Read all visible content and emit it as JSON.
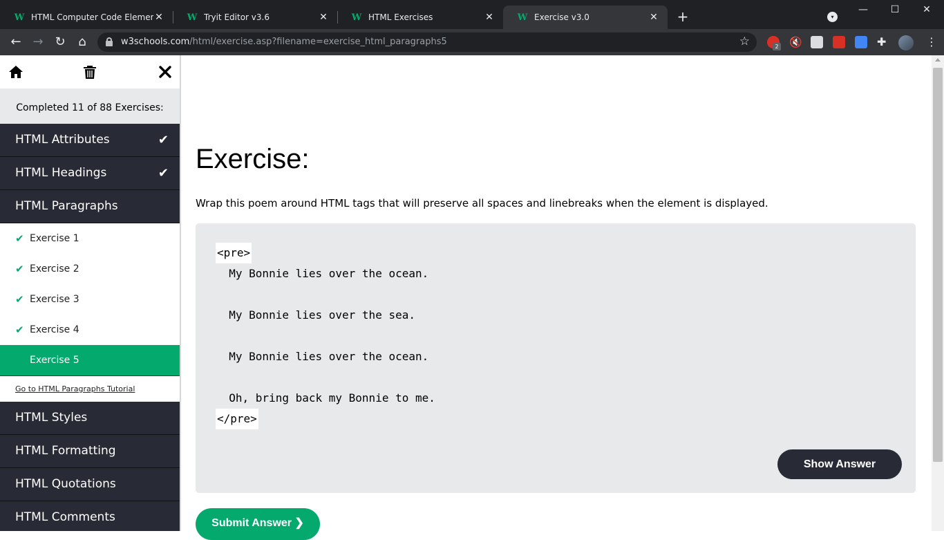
{
  "browser": {
    "tabs": [
      {
        "title": "HTML Computer Code Elements",
        "favicon": "w3schools-icon",
        "active": false
      },
      {
        "title": "Tryit Editor v3.6",
        "favicon": "w3schools-icon",
        "active": false
      },
      {
        "title": "HTML Exercises",
        "favicon": "w3schools-icon",
        "active": false
      },
      {
        "title": "Exercise v3.0",
        "favicon": "w3schools-icon",
        "active": true
      }
    ],
    "favicon_glyph": "W",
    "close_glyph": "✕",
    "new_tab_glyph": "+",
    "url_host": "w3schools.com",
    "url_path": "/html/exercise.asp?filename=exercise_html_paragraphs5",
    "extension_badge": "2"
  },
  "sidebar": {
    "completed_text": "Completed 11 of 88 Exercises:",
    "categories_top": [
      {
        "label": "HTML Attributes",
        "done": true
      },
      {
        "label": "HTML Headings",
        "done": true
      },
      {
        "label": "HTML Paragraphs",
        "done": false
      }
    ],
    "exercises": [
      {
        "label": "Exercise 1",
        "done": true
      },
      {
        "label": "Exercise 2",
        "done": true
      },
      {
        "label": "Exercise 3",
        "done": true
      },
      {
        "label": "Exercise 4",
        "done": true
      },
      {
        "label": "Exercise 5",
        "done": false,
        "active": true
      }
    ],
    "tutorial_link": "Go to HTML Paragraphs Tutorial",
    "categories_bottom": [
      {
        "label": "HTML Styles"
      },
      {
        "label": "HTML Formatting"
      },
      {
        "label": "HTML Quotations"
      },
      {
        "label": "HTML Comments"
      }
    ]
  },
  "exercise": {
    "heading": "Exercise:",
    "instructions": "Wrap this poem around HTML tags that will preserve all spaces and linebreaks when the element is displayed.",
    "open_tag": "<pre>",
    "close_tag": "</pre>",
    "poem_lines": [
      "  My Bonnie lies over the ocean.",
      "",
      "  My Bonnie lies over the sea.",
      "",
      "  My Bonnie lies over the ocean.",
      "",
      "  Oh, bring back my Bonnie to me."
    ],
    "show_answer": "Show Answer",
    "submit_answer": "Submit Answer ❯"
  },
  "colors": {
    "accent": "#04aa6d",
    "sidebar_bg": "#282a35",
    "code_bg": "#e7e9eb"
  }
}
